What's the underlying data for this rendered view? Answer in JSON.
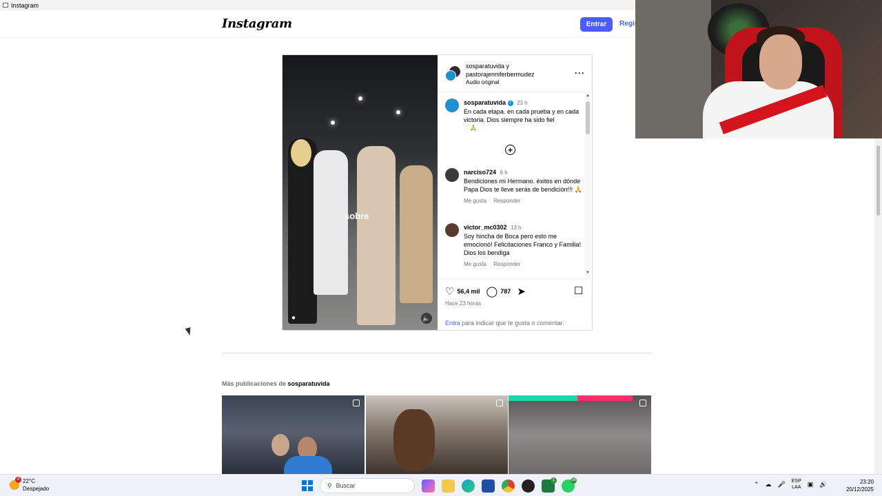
{
  "window": {
    "title": "Instagram"
  },
  "header": {
    "logo": "Instagram",
    "login_label": "Entrar",
    "signup_label": "Registrarte"
  },
  "post": {
    "header_users": "sosparatuvida y",
    "header_users2": "pastorajenniferbermudez",
    "audio": "Audio original",
    "video_overlay_text": "sobre",
    "caption": {
      "user": "sosparatuvida",
      "time": "23 h",
      "text": "En cada etapa. en cada prueba y en cada victoria. Dios siempre ha sido fiel"
    },
    "comments": [
      {
        "user": "narciso724",
        "time": "6 h",
        "text": "Bendiciones mi Hermano. éxitos en dónde Papa Dios te lleve serás de bendición!!! 🙏",
        "like": "Me gusta",
        "reply": "Responder"
      },
      {
        "user": "victor_mc0302",
        "time": "13 h",
        "text": "Soy hincha de Boca pero esto me emocionó! Felicitaciones Franco y Familia! Dios los bendiga",
        "like": "Me gusta",
        "reply": "Responder"
      }
    ],
    "likes": "56,4 mil",
    "comment_count": "787",
    "posted": "Hace 23 horas",
    "login_link": "Entra",
    "login_text": " para indicar que te gusta o comentar."
  },
  "more": {
    "prefix": "Más publicaciones de ",
    "user": "sosparatuvida"
  },
  "taskbar": {
    "weather_temp": "22°C",
    "weather_desc": "Despejado",
    "weather_badge": "4",
    "search_placeholder": "Buscar",
    "lang_top": "ESP",
    "lang_bottom": "LAA",
    "time": "23:20",
    "date": "20/12/2025",
    "badge_excel": "1",
    "badge_whatsapp": "58"
  }
}
